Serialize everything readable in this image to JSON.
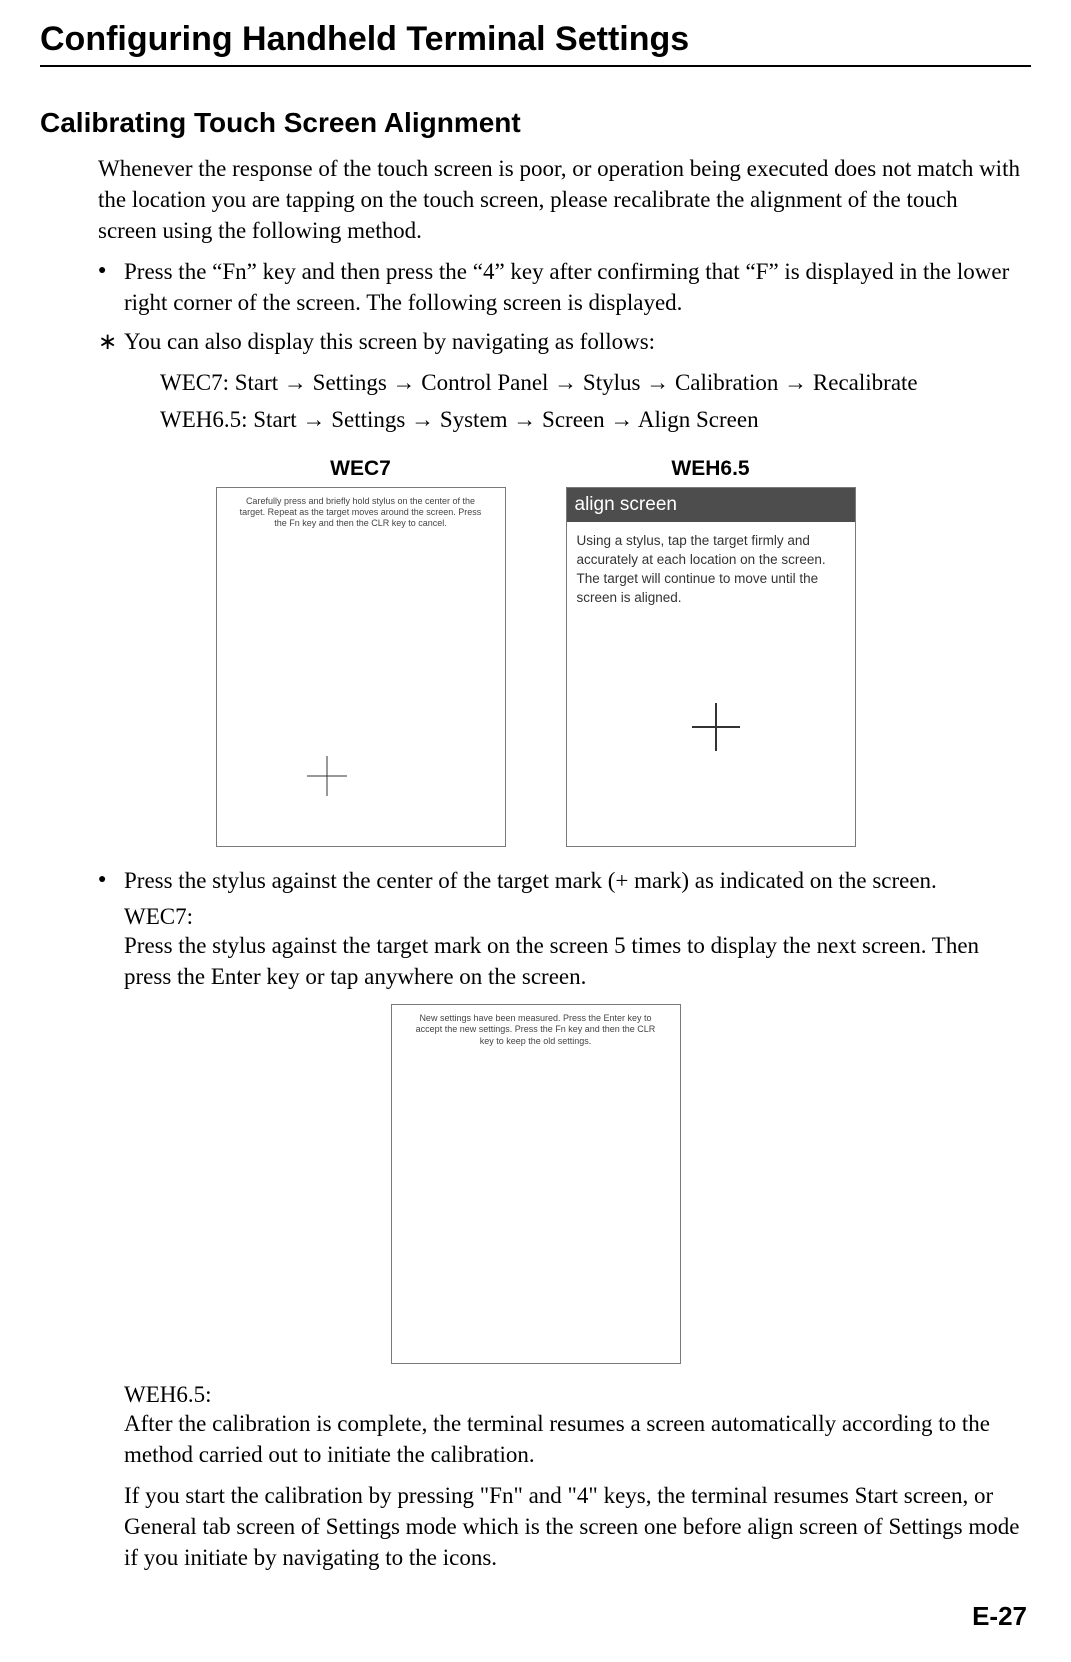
{
  "page": {
    "title": "Configuring Handheld Terminal Settings",
    "section_title": "Calibrating Touch Screen Alignment",
    "intro": "Whenever the response of the touch screen is poor, or operation being executed does not match with the location you are tapping on the touch screen, please recalibrate the alignment of the touch screen using the following method.",
    "bullet1": "Press the “Fn” key and then press the “4” key after confirming that “F” is displayed in the lower right corner of the screen.  The following screen is displayed.",
    "star_note": "You can also display this screen by navigating as follows:",
    "nav_wec7": "WEC7: Start → Settings → Control Panel → Stylus → Calibration → Recalibrate",
    "nav_weh65": "WEH6.5: Start → Settings → System → Screen → Align Screen",
    "fig_wec7_caption": "WEC7",
    "fig_weh65_caption": "WEH6.5",
    "wec7_screen_text": "Carefully press and briefly hold stylus on the center of the target. Repeat as the target moves around the screen. Press the Fn key and then the CLR key to cancel.",
    "weh65_bar": "align screen",
    "weh65_screen_text": "Using a stylus, tap the target firmly and accurately at each location on the screen. The target will continue to move until the screen is aligned.",
    "bullet2": "Press the stylus against the center of the target mark (+ mark) as indicated on the screen.",
    "wec7_label": "WEC7:",
    "wec7_para": "Press the stylus against the target mark on the screen 5 times to display the next screen. Then press the Enter key or tap anywhere on the screen.",
    "wec7_complete_text": "New settings have been measured. Press the Enter key to accept the new settings. Press the Fn key and then the CLR key to keep the old settings.",
    "weh65_label": "WEH6.5:",
    "weh65_para": "After the calibration is complete, the terminal resumes a screen automatically according to the method carried out to initiate the calibration.",
    "final_para": "If you start the calibration by pressing \"Fn\" and \"4\" keys, the terminal resumes Start screen, or General tab screen of Settings mode which is the screen one before align screen of Settings mode if you initiate by navigating to the icons.",
    "page_number": "E-27",
    "markers": {
      "dot": "●",
      "star": "∗"
    }
  }
}
